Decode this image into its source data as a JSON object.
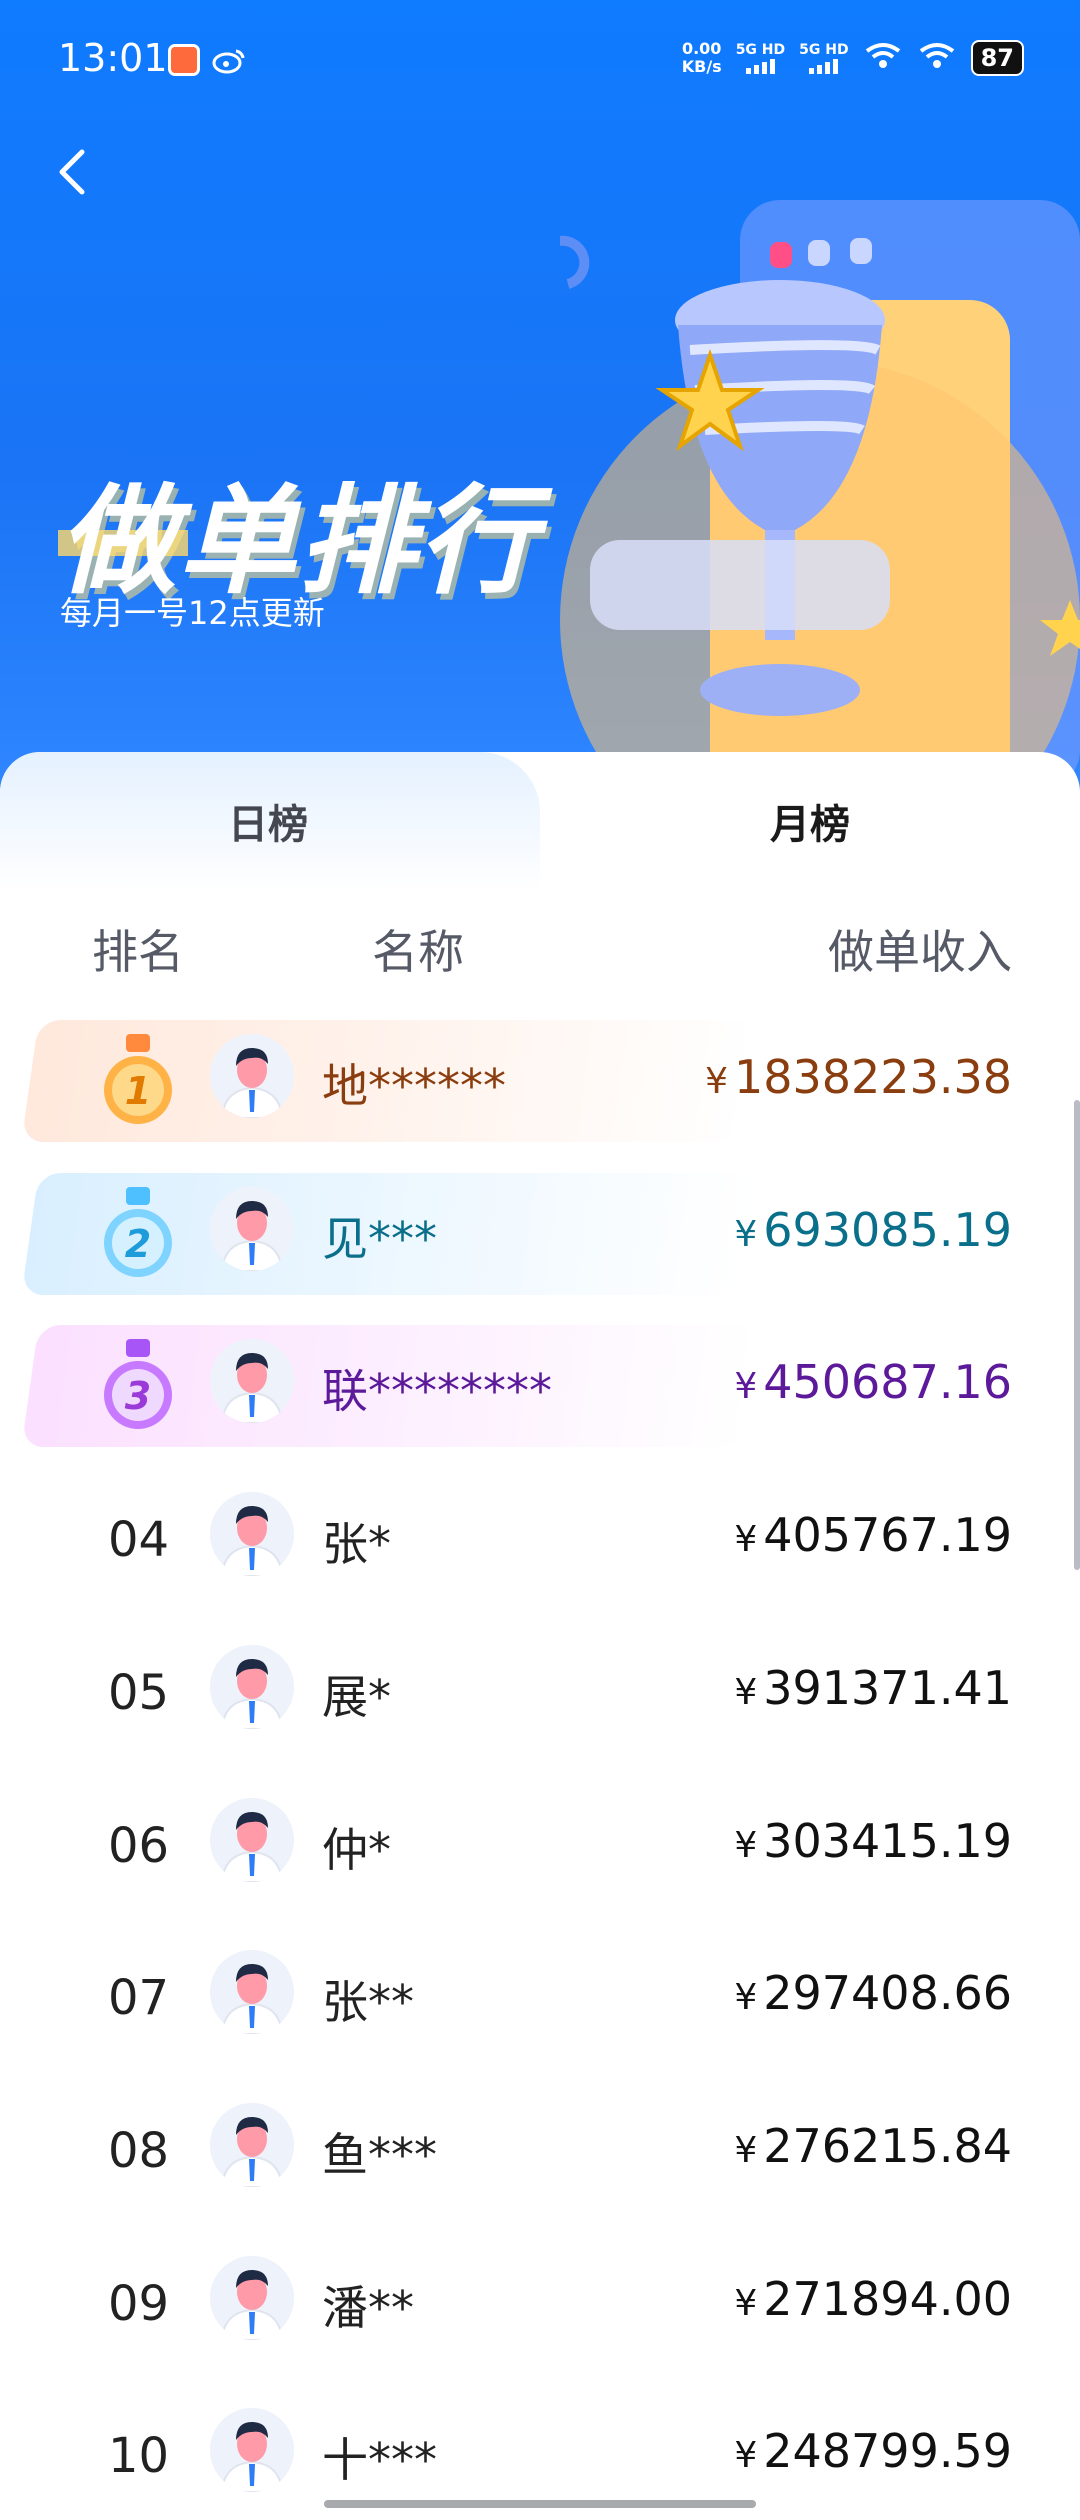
{
  "status_bar": {
    "time": "13:01",
    "net_speed": "0.00",
    "net_unit": "KB/s",
    "sig1": "5G HD",
    "sig2": "5G HD",
    "battery": "87"
  },
  "header": {
    "title": "做单排行",
    "subtitle": "每月一号12点更新",
    "back_icon": "chevron-left-icon"
  },
  "tabs": [
    {
      "label": "日榜",
      "active": false
    },
    {
      "label": "月榜",
      "active": true
    }
  ],
  "columns": {
    "rank": "排名",
    "name": "名称",
    "income": "做单收入"
  },
  "currency": "¥",
  "rankings": [
    {
      "rank": "1",
      "name": "地******",
      "income": "1838223.38",
      "medal": "gold"
    },
    {
      "rank": "2",
      "name": "见***",
      "income": "693085.19",
      "medal": "silver"
    },
    {
      "rank": "3",
      "name": "联********",
      "income": "450687.16",
      "medal": "purple"
    },
    {
      "rank": "04",
      "name": "张*",
      "income": "405767.19"
    },
    {
      "rank": "05",
      "name": "展*",
      "income": "391371.41"
    },
    {
      "rank": "06",
      "name": "仲*",
      "income": "303415.19"
    },
    {
      "rank": "07",
      "name": "张**",
      "income": "297408.66"
    },
    {
      "rank": "08",
      "name": "鱼***",
      "income": "276215.84"
    },
    {
      "rank": "09",
      "name": "潘**",
      "income": "271894.00"
    },
    {
      "rank": "10",
      "name": "十***",
      "income": "248799.59"
    }
  ]
}
